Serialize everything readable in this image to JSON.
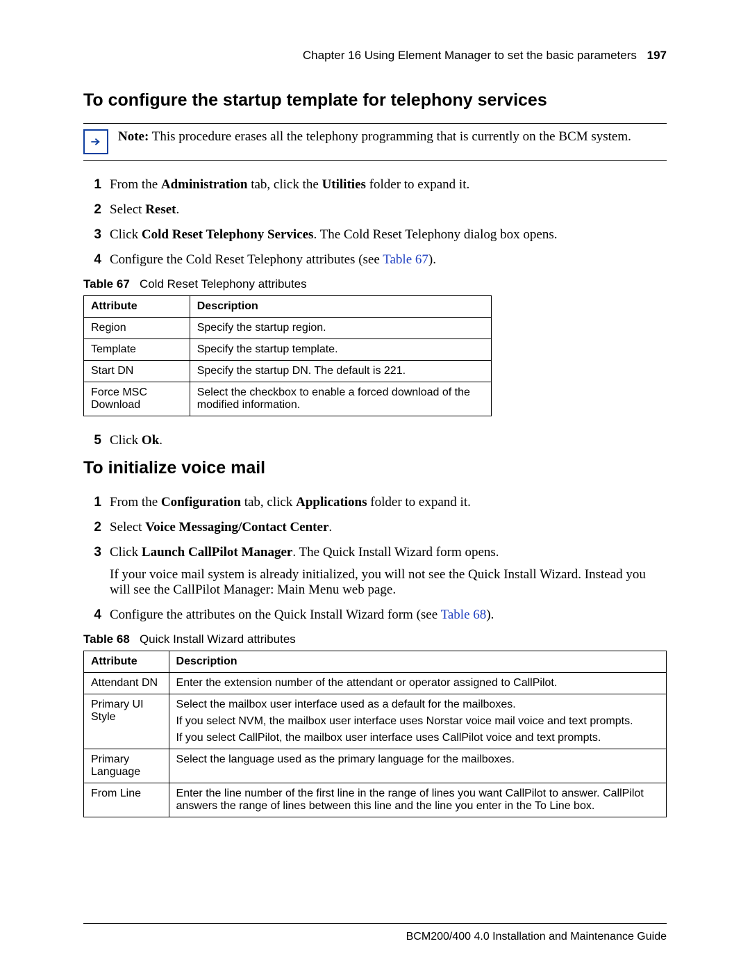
{
  "header": {
    "chapter": "Chapter 16  Using Element Manager to set the basic parameters",
    "pagenum": "197"
  },
  "section1": {
    "title": "To configure the startup template for telephony services",
    "note": {
      "label": "Note:",
      "text": " This procedure erases all the telephony programming that is currently on the BCM system."
    },
    "stepsA": [
      {
        "num": "1",
        "pre": "From the ",
        "b1": "Administration",
        "mid1": " tab, click the ",
        "b2": "Utilities",
        "post": " folder to expand it."
      },
      {
        "num": "2",
        "pre": "Select ",
        "b1": "Reset",
        "post": "."
      },
      {
        "num": "3",
        "pre": "Click ",
        "b1": "Cold Reset Telephony Services",
        "post": ". The Cold Reset Telephony dialog box opens."
      },
      {
        "num": "4",
        "pre": "Configure the Cold Reset Telephony attributes (see ",
        "link": "Table 67",
        "post2": ")."
      }
    ],
    "table67": {
      "label": "Table 67",
      "title": "Cold Reset Telephony attributes",
      "head": {
        "c1": "Attribute",
        "c2": "Description"
      },
      "rows": [
        {
          "c1": "Region",
          "c2": "Specify the startup region."
        },
        {
          "c1": "Template",
          "c2": "Specify the startup template."
        },
        {
          "c1": "Start DN",
          "c2": "Specify the startup DN. The default is 221."
        },
        {
          "c1": "Force MSC Download",
          "c2": "Select the checkbox to enable a forced download of the modified information."
        }
      ]
    },
    "stepsB": [
      {
        "num": "5",
        "pre": "Click ",
        "b1": "Ok",
        "post": "."
      }
    ]
  },
  "section2": {
    "title": "To initialize voice mail",
    "steps": [
      {
        "num": "1",
        "pre": "From the ",
        "b1": "Configuration",
        "mid1": " tab, click ",
        "b2": "Applications",
        "post": " folder to expand it."
      },
      {
        "num": "2",
        "pre": "Select ",
        "b1": "Voice Messaging/Contact Center",
        "post": "."
      },
      {
        "num": "3",
        "pre": "Click ",
        "b1": "Launch CallPilot Manager",
        "post": ". The Quick Install Wizard form opens.",
        "after": "If your voice mail system is already initialized, you will not see the Quick Install Wizard. Instead you will see the CallPilot Manager: Main Menu web page."
      },
      {
        "num": "4",
        "pre": "Configure the attributes on the Quick Install Wizard form (see ",
        "link": "Table 68",
        "post2": ")."
      }
    ],
    "table68": {
      "label": "Table 68",
      "title": "Quick Install Wizard attributes",
      "head": {
        "c1": "Attribute",
        "c2": "Description"
      },
      "rows": [
        {
          "c1": "Attendant DN",
          "c2": "Enter the extension number of the attendant or operator assigned to CallPilot."
        },
        {
          "c1": "Primary UI Style",
          "c2a": "Select the mailbox user interface used as a default for the mailboxes.",
          "c2b": "If you select NVM, the mailbox user interface uses Norstar voice mail voice and text prompts.",
          "c2c": "If you select CallPilot, the mailbox user interface uses CallPilot voice and text prompts."
        },
        {
          "c1": "Primary Language",
          "c2": "Select the language used as the primary language for the mailboxes."
        },
        {
          "c1": "From Line",
          "c2": "Enter the line number of the first line in the range of lines you want CallPilot to answer. CallPilot answers the range of lines between this line and the line you enter in the To Line box."
        }
      ]
    }
  },
  "footer": {
    "text": "BCM200/400 4.0 Installation and Maintenance Guide"
  }
}
